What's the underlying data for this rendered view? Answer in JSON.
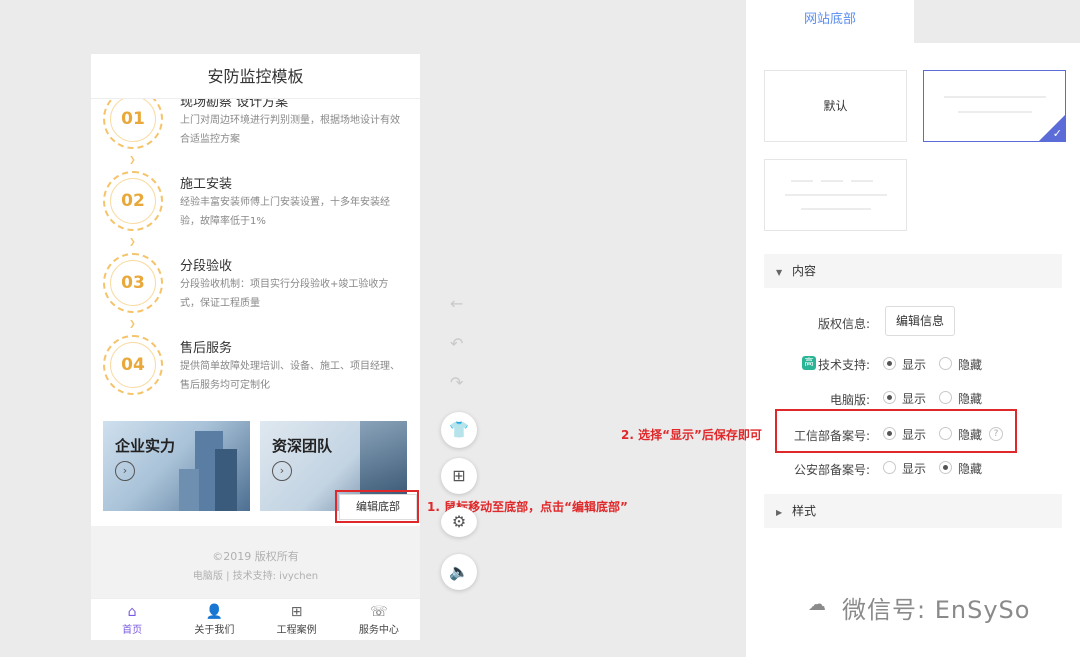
{
  "phone": {
    "title": "安防监控模板",
    "steps": [
      {
        "num": "01",
        "title": "现场勘察 设计方案",
        "desc": "上门对周边环境进行判别测量，根据场地设计有效合适监控方案"
      },
      {
        "num": "02",
        "title": "施工安装",
        "desc": "经验丰富安装师傅上门安装设置，十多年安装经验，故障率低于1%"
      },
      {
        "num": "03",
        "title": "分段验收",
        "desc": "分段验收机制：项目实行分段验收+竣工验收方式，保证工程质量"
      },
      {
        "num": "04",
        "title": "售后服务",
        "desc": "提供简单故障处理培训、设备、施工、项目经理、售后服务均可定制化"
      }
    ],
    "banners": [
      {
        "title": "企业实力",
        "arrow": "›"
      },
      {
        "title": "资深团队",
        "arrow": "›"
      }
    ],
    "footer": {
      "copyright": "©2019 版权所有",
      "links": "电脑版 | 技术支持: ivychen"
    },
    "tabs": [
      {
        "label": "首页",
        "icon": "⌂"
      },
      {
        "label": "关于我们",
        "icon": "👤"
      },
      {
        "label": "工程案例",
        "icon": "⊞"
      },
      {
        "label": "服务中心",
        "icon": "☏"
      }
    ]
  },
  "toolbar": {
    "icons": {
      "back": "←",
      "undo": "↶",
      "redo": "↷",
      "theme": "👕",
      "modules": "⊞",
      "settings": "⚙",
      "audio": "🔈"
    },
    "edit_footer": "编辑底部"
  },
  "annotations": {
    "step1": "1. 鼠标移动至底部，点击“编辑底部”",
    "step2": "2. 选择“显示”后保存即可"
  },
  "panel": {
    "tab": "网站底部",
    "default_layout": "默认",
    "content_section": "内容",
    "style_section": "样式",
    "copyright_label": "版权信息:",
    "edit_info_button": "编辑信息",
    "gao_badge": "高",
    "rows": [
      {
        "label": "技术支持:",
        "show": "显示",
        "hide": "隐藏",
        "selected": "show"
      },
      {
        "label": "电脑版:",
        "show": "显示",
        "hide": "隐藏",
        "selected": "show"
      },
      {
        "label": "工信部备案号:",
        "show": "显示",
        "hide": "隐藏",
        "selected": "show"
      },
      {
        "label": "公安部备案号:",
        "show": "显示",
        "hide": "隐藏",
        "selected": "hide"
      }
    ],
    "help": "?"
  },
  "watermark": "微信号: EnSySo",
  "colors": {
    "accent": "#5b6cd8",
    "tab_blue": "#5b8def",
    "annotation_red": "#e0282a",
    "step_orange": "#e8a83a"
  }
}
